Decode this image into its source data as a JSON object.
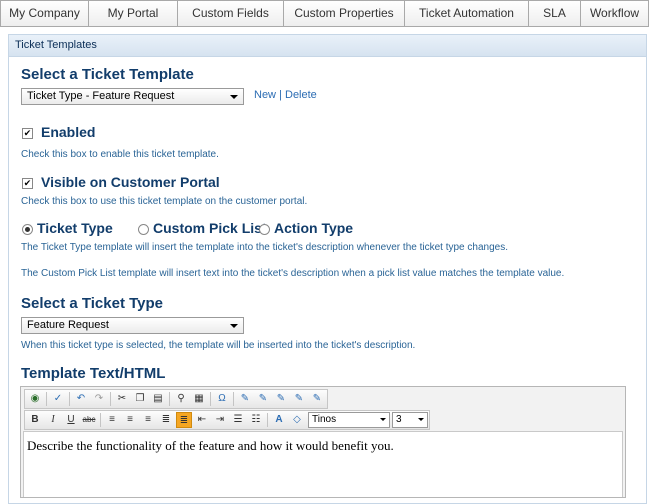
{
  "tabs": [
    "My Company",
    "My Portal",
    "Custom Fields",
    "Custom Properties",
    "Ticket Automation",
    "SLA",
    "Workflow"
  ],
  "panel": {
    "header": "Ticket Templates"
  },
  "template_select": {
    "heading": "Select a Ticket Template",
    "value": "Ticket Type - Feature Request",
    "new_label": "New",
    "divider": "|",
    "delete_label": "Delete"
  },
  "enabled": {
    "checked": true,
    "label": "Enabled",
    "help": "Check this box to enable this ticket template."
  },
  "portal": {
    "checked": true,
    "label": "Visible on Customer Portal",
    "help": "Check this box to use this ticket template on the customer portal."
  },
  "type_radios": {
    "options": [
      "Ticket Type",
      "Custom Pick List",
      "Action Type"
    ],
    "selected": "Ticket Type",
    "help1": "The Ticket Type template will insert the template into the ticket's description whenever the ticket type changes.",
    "help2": "The Custom Pick List template will insert text into the ticket's description when a pick list value matches the template value."
  },
  "ticket_type": {
    "heading": "Select a Ticket Type",
    "value": "Feature Request",
    "help": "When this ticket type is selected, the template will be inserted into the ticket's description."
  },
  "editor": {
    "heading": "Template Text/HTML",
    "font_value": "Tinos",
    "size_value": "3",
    "content": "Describe the functionality of the feature and how it would benefit you."
  }
}
